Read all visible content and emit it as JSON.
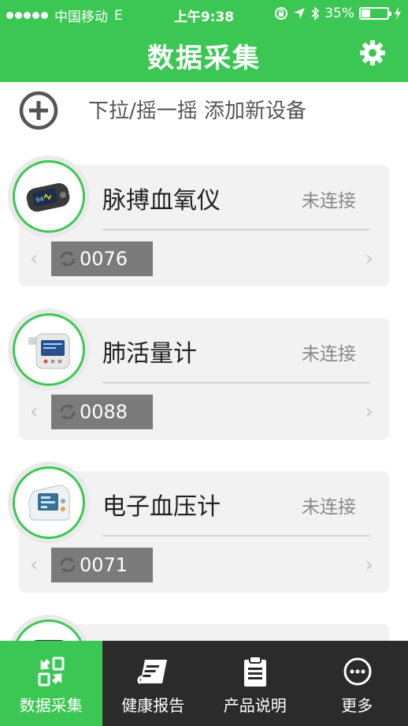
{
  "status_bar": {
    "carrier": "中国移动",
    "network": "E",
    "time": "上午9:38",
    "battery_percent": "35%",
    "battery_level": 0.35
  },
  "navbar": {
    "title": "数据采集",
    "settings_icon": "gear-icon"
  },
  "add_device": {
    "icon": "plus-circle-icon",
    "label": "下拉/摇一摇 添加新设备"
  },
  "devices": [
    {
      "name": "脉搏血氧仪",
      "status": "未连接",
      "id": "0076",
      "image": "pulse-oximeter"
    },
    {
      "name": "肺活量计",
      "status": "未连接",
      "id": "0088",
      "image": "spirometer"
    },
    {
      "name": "电子血压计",
      "status": "未连接",
      "id": "0071",
      "image": "blood-pressure-monitor"
    },
    {
      "name": "",
      "status": "",
      "id": "",
      "image": "device"
    }
  ],
  "tabs": [
    {
      "label": "数据采集",
      "icon": "data-collect-icon",
      "active": true
    },
    {
      "label": "健康报告",
      "icon": "report-icon",
      "active": false
    },
    {
      "label": "产品说明",
      "icon": "clipboard-icon",
      "active": false
    },
    {
      "label": "更多",
      "icon": "more-icon",
      "active": false
    }
  ],
  "colors": {
    "accent": "#3cc754",
    "tabbar": "#2b2b2b",
    "card": "#f2f2f2",
    "id_badge": "#7b7b7b"
  }
}
